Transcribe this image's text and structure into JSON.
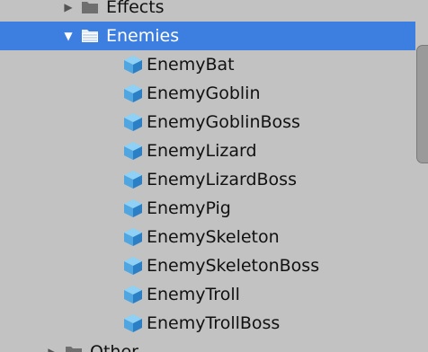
{
  "hierarchy": {
    "top_folder": {
      "label": "Effects",
      "expanded": false
    },
    "open_folder": {
      "label": "Enemies",
      "expanded": true,
      "selected": true
    },
    "items": [
      {
        "label": "EnemyBat",
        "icon": "prefab-cube-icon"
      },
      {
        "label": "EnemyGoblin",
        "icon": "prefab-cube-icon"
      },
      {
        "label": "EnemyGoblinBoss",
        "icon": "prefab-cube-icon"
      },
      {
        "label": "EnemyLizard",
        "icon": "prefab-cube-icon"
      },
      {
        "label": "EnemyLizardBoss",
        "icon": "prefab-cube-icon"
      },
      {
        "label": "EnemyPig",
        "icon": "prefab-cube-icon"
      },
      {
        "label": "EnemySkeleton",
        "icon": "prefab-cube-icon"
      },
      {
        "label": "EnemySkeletonBoss",
        "icon": "prefab-cube-icon"
      },
      {
        "label": "EnemyTroll",
        "icon": "prefab-cube-icon"
      },
      {
        "label": "EnemyTrollBoss",
        "icon": "prefab-cube-icon"
      }
    ],
    "bottom_folder": {
      "label": "Other",
      "expanded": false
    }
  },
  "colors": {
    "background": "#c2c2c2",
    "selection": "#3d7fe0",
    "cube_light": "#8fd0f5",
    "cube_mid": "#4fa6e0",
    "cube_dark": "#2b7fc4"
  }
}
